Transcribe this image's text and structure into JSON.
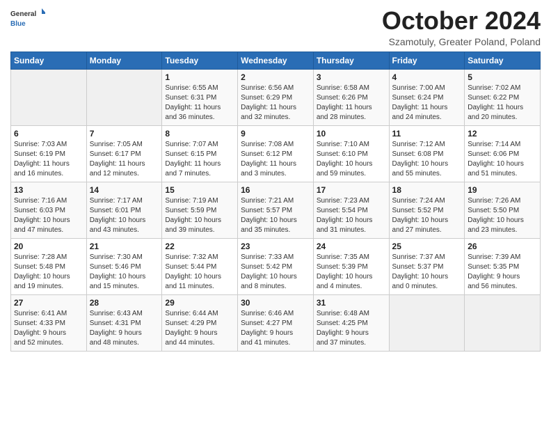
{
  "logo": {
    "general": "General",
    "blue": "Blue"
  },
  "header": {
    "month": "October 2024",
    "location": "Szamotuly, Greater Poland, Poland"
  },
  "days_of_week": [
    "Sunday",
    "Monday",
    "Tuesday",
    "Wednesday",
    "Thursday",
    "Friday",
    "Saturday"
  ],
  "weeks": [
    [
      {
        "day": "",
        "info": ""
      },
      {
        "day": "",
        "info": ""
      },
      {
        "day": "1",
        "info": "Sunrise: 6:55 AM\nSunset: 6:31 PM\nDaylight: 11 hours\nand 36 minutes."
      },
      {
        "day": "2",
        "info": "Sunrise: 6:56 AM\nSunset: 6:29 PM\nDaylight: 11 hours\nand 32 minutes."
      },
      {
        "day": "3",
        "info": "Sunrise: 6:58 AM\nSunset: 6:26 PM\nDaylight: 11 hours\nand 28 minutes."
      },
      {
        "day": "4",
        "info": "Sunrise: 7:00 AM\nSunset: 6:24 PM\nDaylight: 11 hours\nand 24 minutes."
      },
      {
        "day": "5",
        "info": "Sunrise: 7:02 AM\nSunset: 6:22 PM\nDaylight: 11 hours\nand 20 minutes."
      }
    ],
    [
      {
        "day": "6",
        "info": "Sunrise: 7:03 AM\nSunset: 6:19 PM\nDaylight: 11 hours\nand 16 minutes."
      },
      {
        "day": "7",
        "info": "Sunrise: 7:05 AM\nSunset: 6:17 PM\nDaylight: 11 hours\nand 12 minutes."
      },
      {
        "day": "8",
        "info": "Sunrise: 7:07 AM\nSunset: 6:15 PM\nDaylight: 11 hours\nand 7 minutes."
      },
      {
        "day": "9",
        "info": "Sunrise: 7:08 AM\nSunset: 6:12 PM\nDaylight: 11 hours\nand 3 minutes."
      },
      {
        "day": "10",
        "info": "Sunrise: 7:10 AM\nSunset: 6:10 PM\nDaylight: 10 hours\nand 59 minutes."
      },
      {
        "day": "11",
        "info": "Sunrise: 7:12 AM\nSunset: 6:08 PM\nDaylight: 10 hours\nand 55 minutes."
      },
      {
        "day": "12",
        "info": "Sunrise: 7:14 AM\nSunset: 6:06 PM\nDaylight: 10 hours\nand 51 minutes."
      }
    ],
    [
      {
        "day": "13",
        "info": "Sunrise: 7:16 AM\nSunset: 6:03 PM\nDaylight: 10 hours\nand 47 minutes."
      },
      {
        "day": "14",
        "info": "Sunrise: 7:17 AM\nSunset: 6:01 PM\nDaylight: 10 hours\nand 43 minutes."
      },
      {
        "day": "15",
        "info": "Sunrise: 7:19 AM\nSunset: 5:59 PM\nDaylight: 10 hours\nand 39 minutes."
      },
      {
        "day": "16",
        "info": "Sunrise: 7:21 AM\nSunset: 5:57 PM\nDaylight: 10 hours\nand 35 minutes."
      },
      {
        "day": "17",
        "info": "Sunrise: 7:23 AM\nSunset: 5:54 PM\nDaylight: 10 hours\nand 31 minutes."
      },
      {
        "day": "18",
        "info": "Sunrise: 7:24 AM\nSunset: 5:52 PM\nDaylight: 10 hours\nand 27 minutes."
      },
      {
        "day": "19",
        "info": "Sunrise: 7:26 AM\nSunset: 5:50 PM\nDaylight: 10 hours\nand 23 minutes."
      }
    ],
    [
      {
        "day": "20",
        "info": "Sunrise: 7:28 AM\nSunset: 5:48 PM\nDaylight: 10 hours\nand 19 minutes."
      },
      {
        "day": "21",
        "info": "Sunrise: 7:30 AM\nSunset: 5:46 PM\nDaylight: 10 hours\nand 15 minutes."
      },
      {
        "day": "22",
        "info": "Sunrise: 7:32 AM\nSunset: 5:44 PM\nDaylight: 10 hours\nand 11 minutes."
      },
      {
        "day": "23",
        "info": "Sunrise: 7:33 AM\nSunset: 5:42 PM\nDaylight: 10 hours\nand 8 minutes."
      },
      {
        "day": "24",
        "info": "Sunrise: 7:35 AM\nSunset: 5:39 PM\nDaylight: 10 hours\nand 4 minutes."
      },
      {
        "day": "25",
        "info": "Sunrise: 7:37 AM\nSunset: 5:37 PM\nDaylight: 10 hours\nand 0 minutes."
      },
      {
        "day": "26",
        "info": "Sunrise: 7:39 AM\nSunset: 5:35 PM\nDaylight: 9 hours\nand 56 minutes."
      }
    ],
    [
      {
        "day": "27",
        "info": "Sunrise: 6:41 AM\nSunset: 4:33 PM\nDaylight: 9 hours\nand 52 minutes."
      },
      {
        "day": "28",
        "info": "Sunrise: 6:43 AM\nSunset: 4:31 PM\nDaylight: 9 hours\nand 48 minutes."
      },
      {
        "day": "29",
        "info": "Sunrise: 6:44 AM\nSunset: 4:29 PM\nDaylight: 9 hours\nand 44 minutes."
      },
      {
        "day": "30",
        "info": "Sunrise: 6:46 AM\nSunset: 4:27 PM\nDaylight: 9 hours\nand 41 minutes."
      },
      {
        "day": "31",
        "info": "Sunrise: 6:48 AM\nSunset: 4:25 PM\nDaylight: 9 hours\nand 37 minutes."
      },
      {
        "day": "",
        "info": ""
      },
      {
        "day": "",
        "info": ""
      }
    ]
  ]
}
